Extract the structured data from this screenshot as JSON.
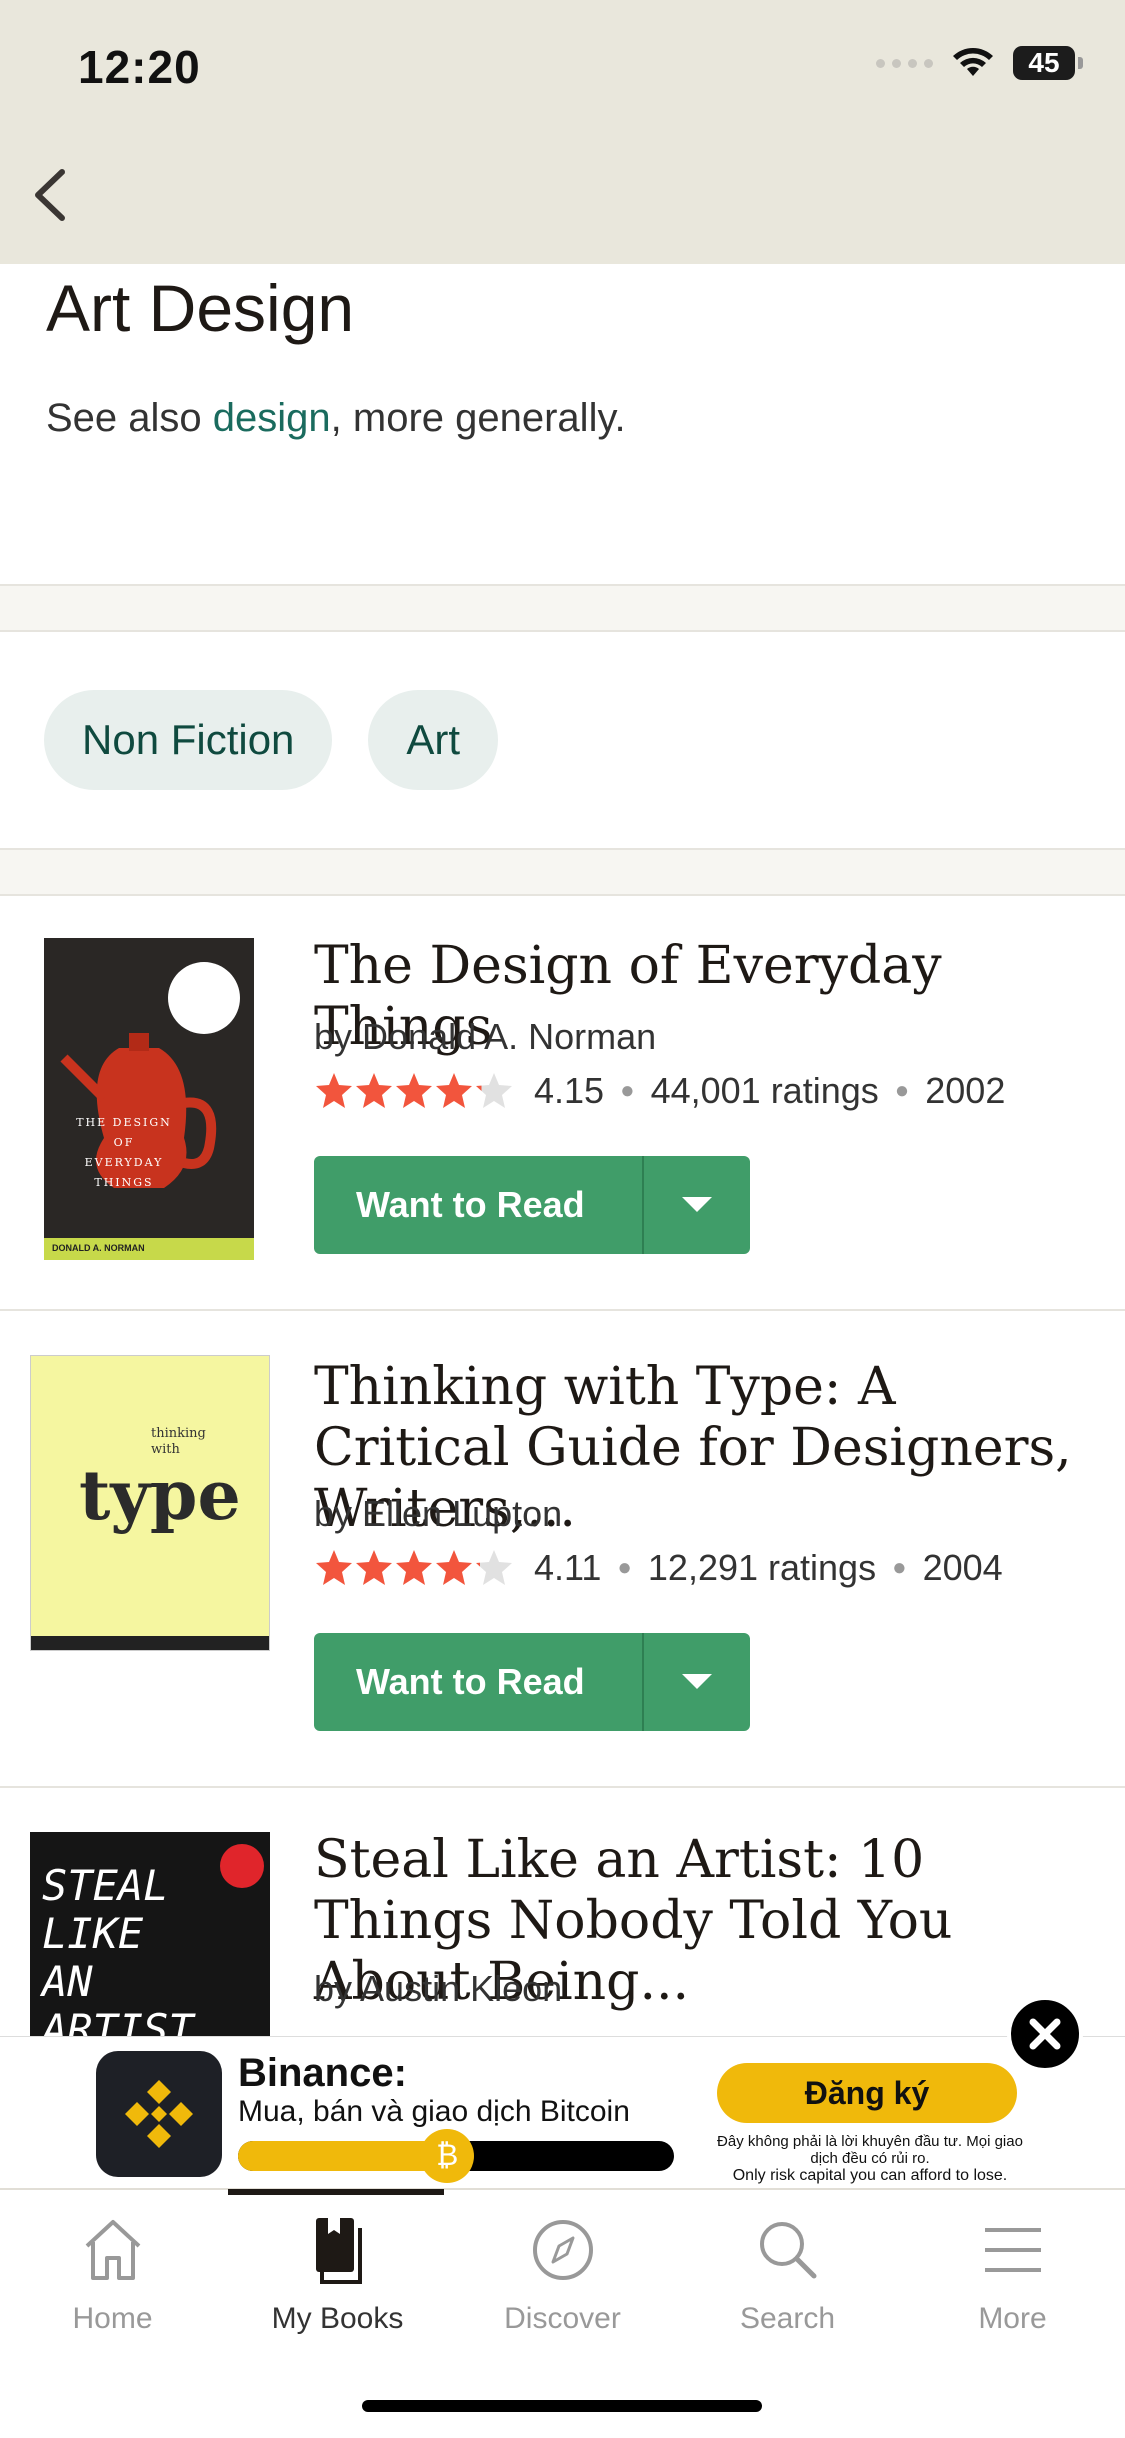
{
  "status_bar": {
    "time": "12:20",
    "battery": "45"
  },
  "page": {
    "title": "Art Design",
    "subtitle_prefix": "See also ",
    "subtitle_link": "design",
    "subtitle_suffix": ", more generally."
  },
  "tags": [
    {
      "label": "Non Fiction"
    },
    {
      "label": "Art"
    }
  ],
  "books": [
    {
      "title": "The Design of Everyday Things",
      "author": "by Donald A. Norman",
      "rating": "4.15",
      "rating_value": 4.15,
      "ratings_count": "44,001 ratings",
      "year": "2002",
      "button": "Want to Read",
      "cover_text": "THE DESIGN OF EVERYDAY THINGS",
      "cover_author": "DONALD A. NORMAN"
    },
    {
      "title": "Thinking with Type: A Critical Guide for Designers, Writers,...",
      "author": "by Ellen Lupton",
      "rating": "4.11",
      "rating_value": 4.11,
      "ratings_count": "12,291 ratings",
      "year": "2004",
      "button": "Want to Read",
      "cover_small": "thinking with",
      "cover_big": "type"
    },
    {
      "title": "Steal Like an Artist: 10 Things Nobody Told You About Being...",
      "author": "by Austin Kleon",
      "cover_text": "STEAL LIKE AN ARTIST"
    }
  ],
  "ad": {
    "title": "Binance:",
    "subtitle": "Mua, bán và giao dịch Bitcoin",
    "cta": "Đăng ký",
    "disclaimer_1": "Đây không phải là lời khuyên đầu tư. Mọi giao dịch đều có rủi ro.",
    "disclaimer_2": "Only risk capital you can afford to lose.",
    "progress": 0.48,
    "colors": {
      "brand": "#f0b90b",
      "logo_bg": "#1e2026"
    }
  },
  "tabs": [
    {
      "label": "Home",
      "icon": "home-icon"
    },
    {
      "label": "My Books",
      "icon": "books-icon"
    },
    {
      "label": "Discover",
      "icon": "compass-icon"
    },
    {
      "label": "Search",
      "icon": "search-icon"
    },
    {
      "label": "More",
      "icon": "menu-icon"
    }
  ],
  "colors": {
    "accent_green": "#409d69",
    "link": "#1a6b5e",
    "star": "#f2553d",
    "header_bg": "#e9e7dc"
  }
}
